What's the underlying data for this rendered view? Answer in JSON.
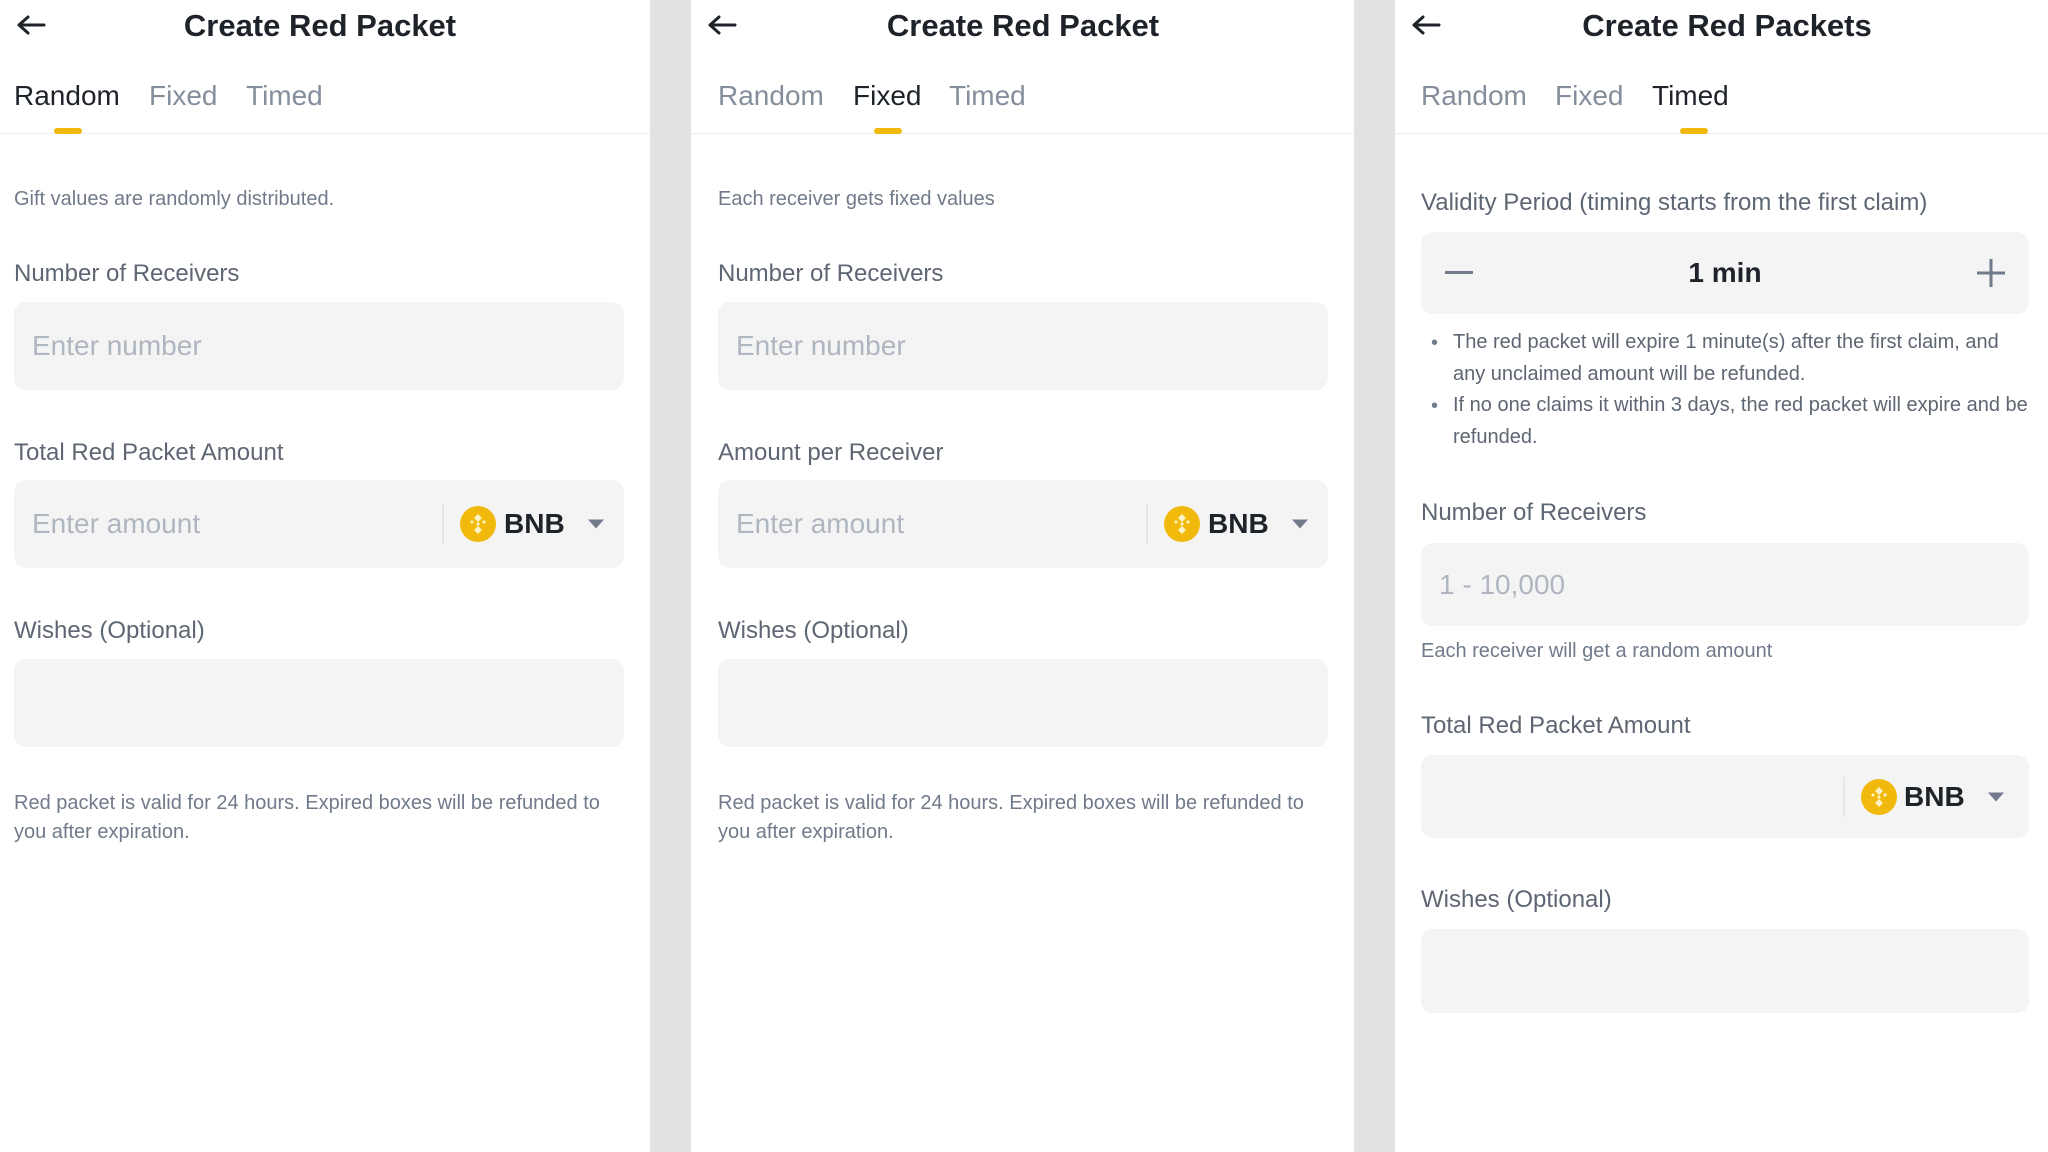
{
  "colors": {
    "accent": "#f0b90b",
    "primary_text": "#1e2329",
    "muted_text": "#848e9c",
    "field_bg": "#f4f4f5"
  },
  "panels": [
    {
      "title": "Create Red Packet",
      "tabs": [
        "Random",
        "Fixed",
        "Timed"
      ],
      "active_tab": "Random",
      "hint": "Gift values are randomly distributed.",
      "receivers_label": "Number of Receivers",
      "receivers_placeholder": "Enter number",
      "amount_label": "Total Red Packet Amount",
      "amount_placeholder": "Enter amount",
      "coin": "BNB",
      "wishes_label": "Wishes (Optional)",
      "note": "Red packet is valid for 24 hours. Expired boxes will be refunded to you after expiration."
    },
    {
      "title": "Create Red Packet",
      "tabs": [
        "Random",
        "Fixed",
        "Timed"
      ],
      "active_tab": "Fixed",
      "hint": "Each receiver gets fixed values",
      "receivers_label": "Number of Receivers",
      "receivers_placeholder": "Enter number",
      "amount_label": "Amount per Receiver",
      "amount_placeholder": "Enter amount",
      "coin": "BNB",
      "wishes_label": "Wishes (Optional)",
      "note": "Red packet is valid for 24 hours. Expired boxes will be refunded to you after expiration."
    },
    {
      "title": "Create Red Packets",
      "tabs": [
        "Random",
        "Fixed",
        "Timed"
      ],
      "active_tab": "Timed",
      "validity_label": "Validity Period (timing starts from the first claim)",
      "validity_value": "1 min",
      "bullets": [
        "The red packet will expire 1 minute(s) after the first claim, and any unclaimed amount will be refunded.",
        "If no one claims it within 3 days, the red packet will expire and be refunded."
      ],
      "receivers_label": "Number of Receivers",
      "receivers_placeholder": "1 - 10,000",
      "receivers_hint": "Each receiver will get a random amount",
      "amount_label": "Total Red Packet Amount",
      "coin": "BNB",
      "wishes_label": "Wishes (Optional)"
    }
  ],
  "icons": {
    "back": "arrow-left-icon",
    "coin": "bnb-coin-icon",
    "dropdown": "caret-down-icon",
    "minus": "minus-icon",
    "plus": "plus-icon"
  }
}
